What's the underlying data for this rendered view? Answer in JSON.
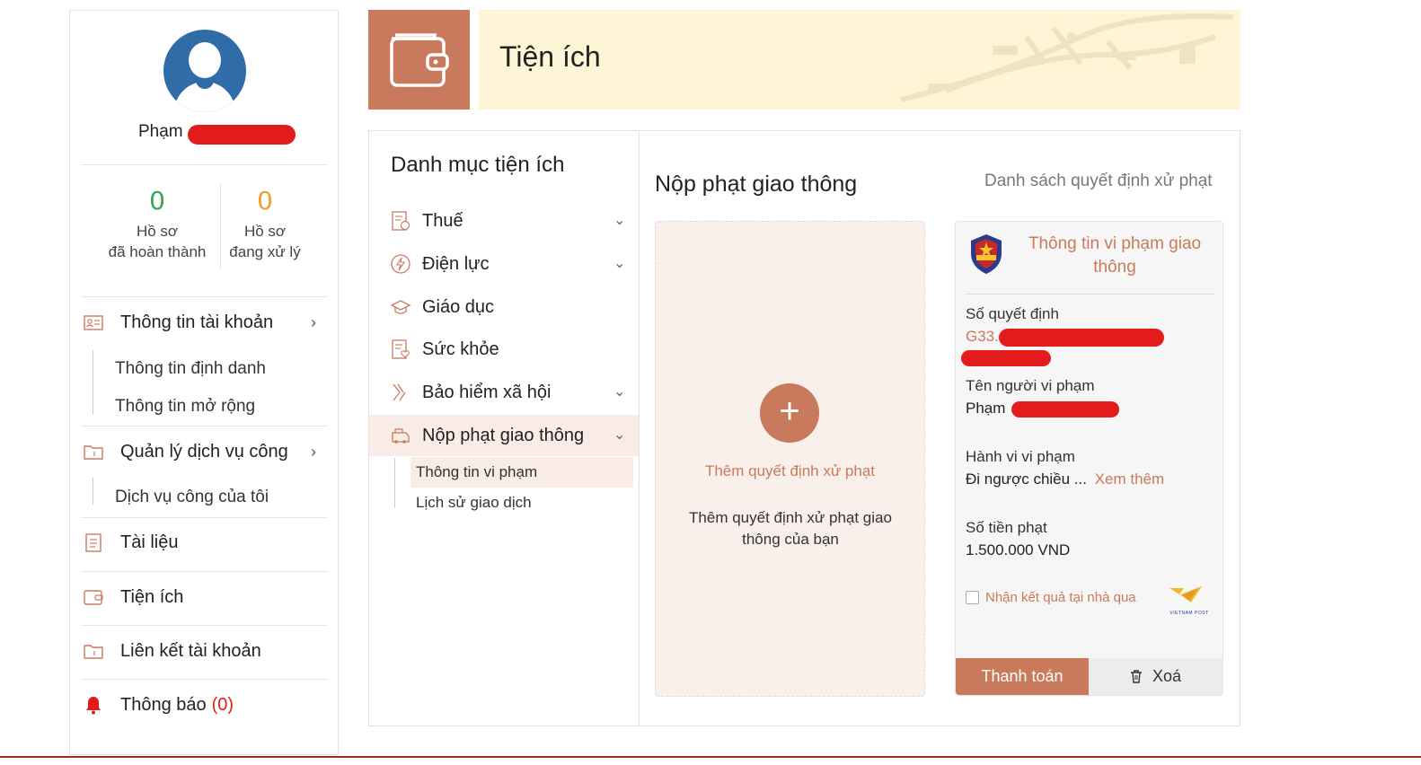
{
  "sidebar": {
    "user_name": "Phạm",
    "stats": [
      {
        "value": "0",
        "line1": "Hồ sơ",
        "line2": "đã hoàn thành",
        "color": "#3aa757"
      },
      {
        "value": "0",
        "line1": "Hồ sơ",
        "line2": "đang xử lý",
        "color": "#f0a12b"
      }
    ],
    "menu": {
      "account": "Thông tin tài khoản",
      "account_sub": [
        "Thông tin định danh",
        "Thông tin mở rộng"
      ],
      "services": "Quản lý dịch vụ công",
      "services_sub": [
        "Dịch vụ công của tôi"
      ],
      "documents": "Tài liệu",
      "utilities": "Tiện ích",
      "link_account": "Liên kết tài khoản",
      "notifications": "Thông báo",
      "notifications_count": "(0)"
    }
  },
  "header": {
    "title": "Tiện ích"
  },
  "categories": {
    "title": "Danh mục tiện ích",
    "items": [
      "Thuế",
      "Điện lực",
      "Giáo dục",
      "Sức khỏe",
      "Bảo hiểm xã hội",
      "Nộp phạt giao thông"
    ],
    "sub": [
      "Thông tin vi phạm",
      "Lịch sử giao dịch"
    ]
  },
  "section": {
    "title": "Nộp phạt giao thông",
    "link": "Danh sách quyết định xử phạt"
  },
  "add_box": {
    "plus": "+",
    "title": "Thêm quyết định xử phạt",
    "desc": "Thêm quyết định xử phạt giao thông của bạn"
  },
  "card": {
    "title": "Thông tin vi phạm giao thông",
    "decision_label": "Số quyết định",
    "decision_value": "G33.",
    "violator_label": "Tên người vi phạm",
    "violator_value": "Phạm",
    "behavior_label": "Hành vi vi phạm",
    "behavior_value": "Đi ngược chiều ...",
    "see_more": "Xem thêm",
    "fine_label": "Số tiền phạt",
    "fine_value": "1.500.000 VND",
    "home_delivery": "Nhận kết quả tại nhà qua",
    "post_brand": "VIETNAM POST",
    "pay_button": "Thanh toán",
    "delete_button": "Xoá"
  },
  "colors": {
    "accent": "#c97a5c",
    "banner": "#fdf5d6",
    "avatar": "#2f6ca8",
    "alert": "#e41b1b"
  }
}
